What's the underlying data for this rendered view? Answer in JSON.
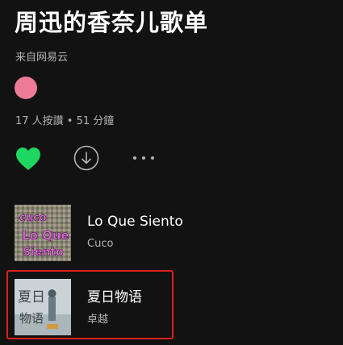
{
  "playlist": {
    "title": "周迅的香奈儿歌单",
    "source": "来自网易云",
    "stats": "17 人按讚 • 51 分鐘"
  },
  "actions": {
    "like_icon": "heart-icon",
    "download_icon": "download-icon",
    "more_icon": "more-icon"
  },
  "colors": {
    "background": "#121212",
    "accent_green": "#1ed760",
    "avatar_pink": "#ee7b95",
    "highlight_red": "#e01e1e"
  },
  "tracks": [
    {
      "name": "Lo Que Siento",
      "artist": "Cuco",
      "cover_text": [
        "cuco",
        "Lo Que",
        "Siento"
      ]
    },
    {
      "name": "夏日物语",
      "artist": "卓越",
      "cover_text": [
        "夏日",
        "物语"
      ]
    }
  ]
}
